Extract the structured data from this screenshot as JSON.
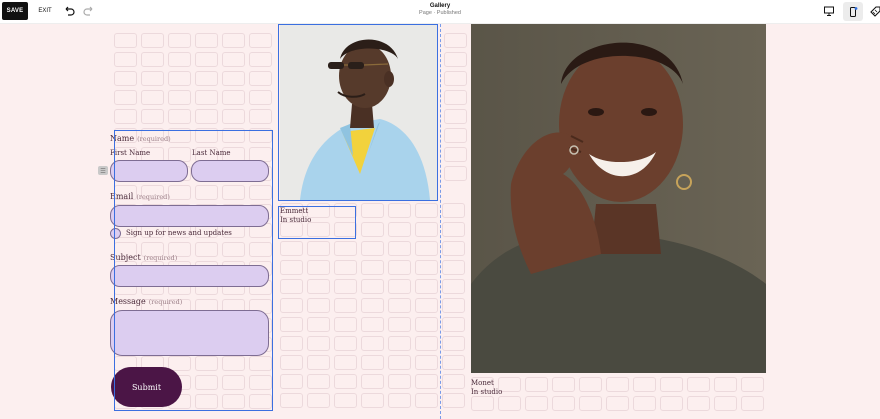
{
  "toolbar": {
    "save_label": "SAVE",
    "exit_label": "EXIT",
    "page_title": "Gallery",
    "page_status": "Page · Published"
  },
  "form": {
    "name_label": "Name",
    "name_required": "(required)",
    "first_name_label": "First Name",
    "last_name_label": "Last Name",
    "email_label": "Email",
    "email_required": "(required)",
    "newsletter_label": "Sign up for news and updates",
    "subject_label": "Subject",
    "subject_required": "(required)",
    "message_label": "Message",
    "message_required": "(required)",
    "submit_label": "Submit"
  },
  "gallery": {
    "items": [
      {
        "name": "Emmett",
        "caption": "In studio"
      },
      {
        "name": "Monet",
        "caption": "In studio"
      }
    ]
  },
  "colors": {
    "background": "#fcefef",
    "field_fill": "#dccdf0",
    "submit_fill": "#4b1546",
    "selection": "#3b6fe0"
  }
}
